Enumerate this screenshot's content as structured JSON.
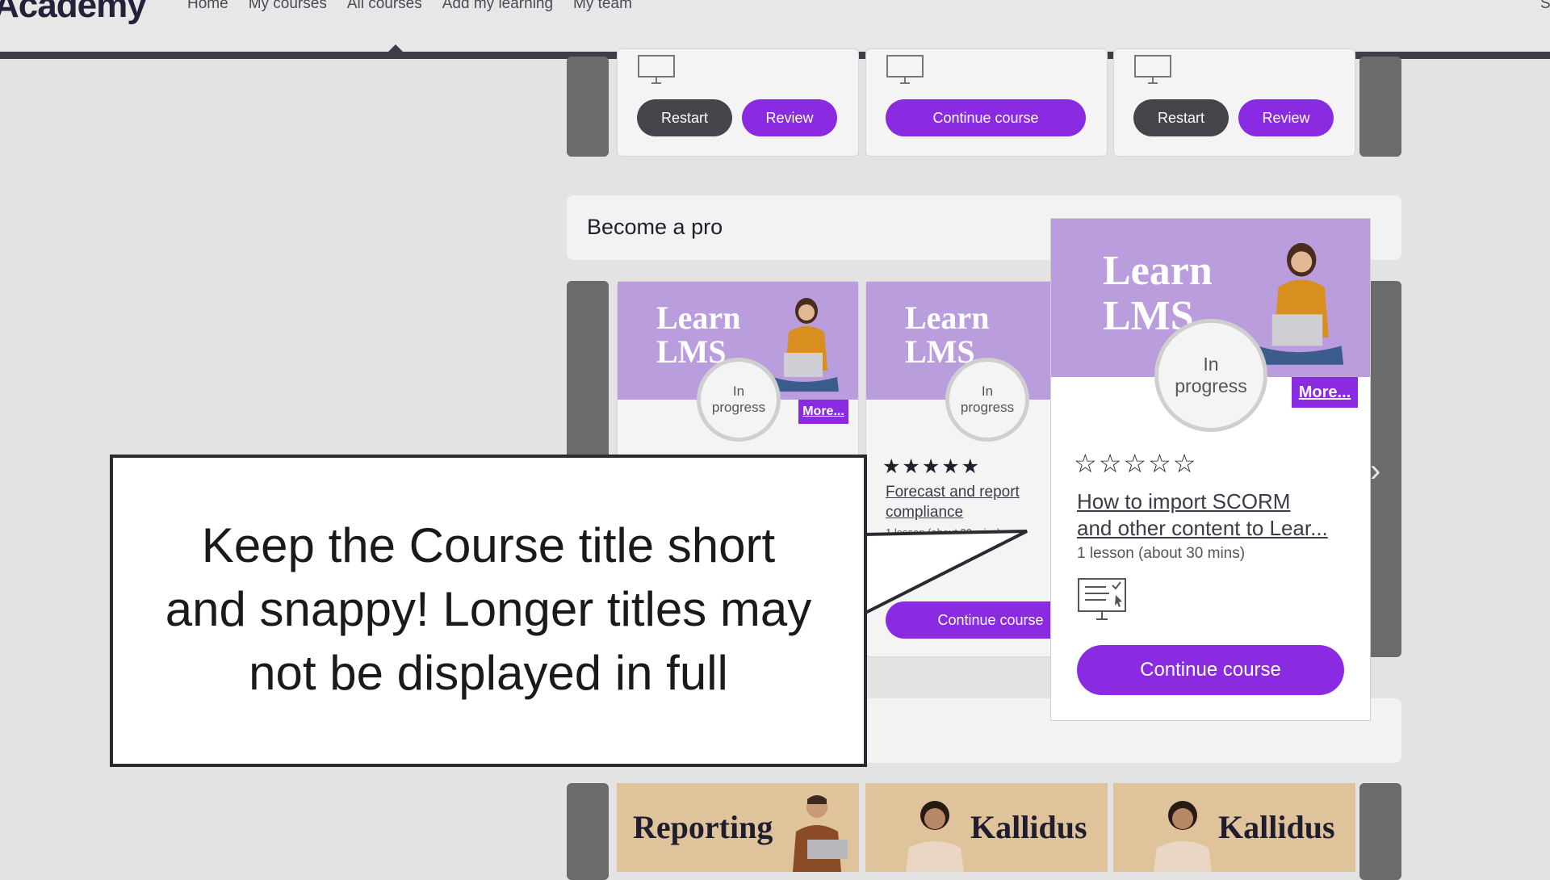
{
  "nav": {
    "logo": "Academy",
    "items": [
      "Home",
      "My courses",
      "All courses",
      "Add my learning",
      "My team"
    ],
    "cut_right": "S"
  },
  "top_row": {
    "card1": {
      "restart": "Restart",
      "review": "Review"
    },
    "card2": {
      "continue": "Continue course"
    },
    "card3": {
      "restart": "Restart",
      "review": "Review"
    }
  },
  "section": {
    "title": "Become a pro"
  },
  "courses": {
    "thumb_line1": "Learn",
    "thumb_line2": "LMS",
    "status_l1": "In",
    "status_l2": "progress",
    "more": "More...",
    "card2": {
      "stars": "★★★★★",
      "title_l1": "Forecast and report",
      "title_l2": "compliance",
      "meta": "1 lesson (about 30 mins)",
      "continue": "Continue course"
    }
  },
  "popup": {
    "thumb_line1": "Learn",
    "thumb_line2": "LMS",
    "status_l1": "In",
    "status_l2": "progress",
    "more": "More...",
    "stars": "☆☆☆☆☆",
    "title_l1": "How to import SCORM",
    "title_l2": "and other content to Lear...",
    "meta": "1 lesson (about 30 mins)",
    "continue": "Continue course"
  },
  "callout": {
    "line1": "Keep the Course title short",
    "line2": "and snappy! Longer titles may",
    "line3": "not be displayed in full"
  },
  "bottom_row": {
    "thumb1": "Reporting",
    "thumb2": "Kallidus",
    "thumb3": "Kallidus"
  },
  "colors": {
    "accent": "#8a2be2",
    "dark": "#45444b",
    "thumb_purple": "#b99ddd",
    "thumb_tan": "#dfc39b"
  }
}
